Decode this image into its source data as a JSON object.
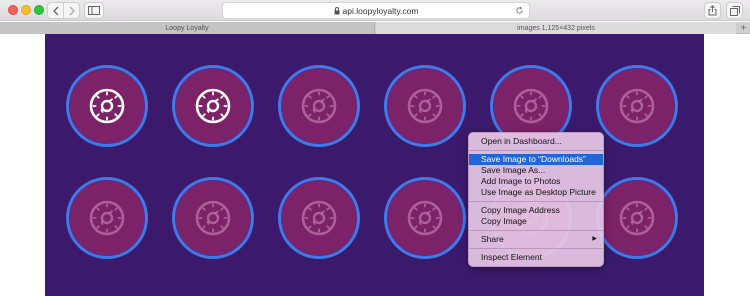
{
  "toolbar": {
    "address": "api.loopyloyalty.com"
  },
  "tabs": [
    {
      "label": "Loopy Loyalty"
    },
    {
      "label": "images 1,125×432 pixels"
    }
  ],
  "colors": {
    "image_bg": "#3b1a6d",
    "donut_fill": "#7c2268",
    "donut_ring": "#3f7ae6",
    "menu_highlight": "#2165d7"
  },
  "stamps": [
    {
      "state": "active"
    },
    {
      "state": "active"
    },
    {
      "state": "inactive"
    },
    {
      "state": "inactive"
    },
    {
      "state": "inactive"
    },
    {
      "state": "inactive"
    },
    {
      "state": "inactive"
    },
    {
      "state": "inactive"
    },
    {
      "state": "inactive"
    },
    {
      "state": "inactive"
    },
    {
      "state": "inactive"
    },
    {
      "state": "inactive"
    }
  ],
  "context_menu": {
    "open_dashboard": "Open in Dashboard...",
    "save_downloads": "Save Image to “Downloads”",
    "save_as": "Save Image As...",
    "add_photos": "Add Image to Photos",
    "desktop_picture": "Use Image as Desktop Picture",
    "copy_address": "Copy Image Address",
    "copy_image": "Copy Image",
    "share": "Share",
    "inspect": "Inspect Element"
  }
}
